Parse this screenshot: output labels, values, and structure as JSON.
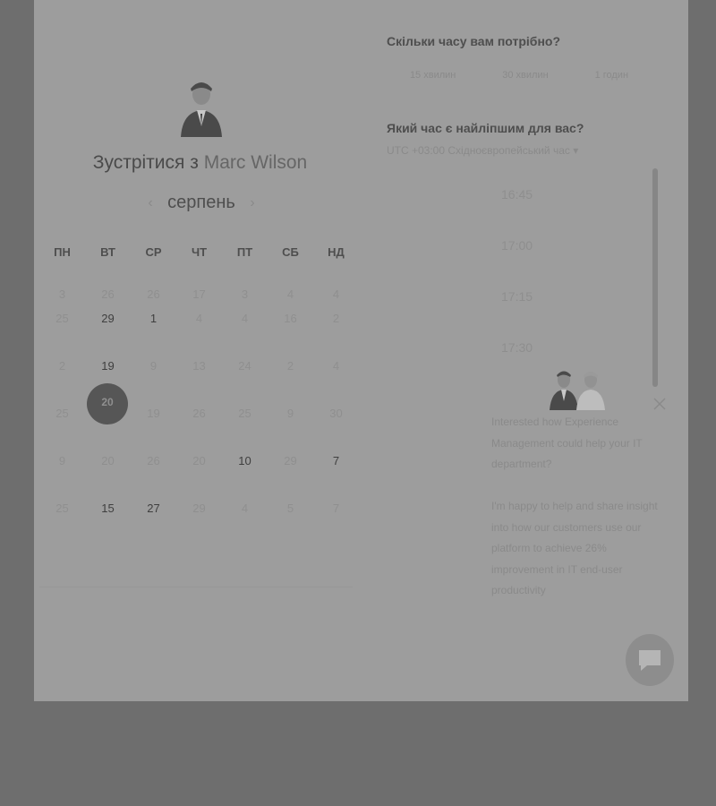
{
  "header": {
    "title_prefix": "Зустрітися з ",
    "host_name": "Marc Wilson",
    "month": "серпень",
    "prev_icon": "chevron-left-icon",
    "next_icon": "chevron-right-icon"
  },
  "calendar": {
    "weekdays": [
      "ПН",
      "ВТ",
      "СР",
      "ЧТ",
      "ПТ",
      "СБ",
      "НД"
    ],
    "weeks": [
      [
        "3",
        "26",
        "26",
        "17",
        "3",
        "4",
        "4"
      ],
      [
        "25",
        "29",
        "1",
        "4",
        "4",
        "16",
        "2"
      ],
      [
        "2",
        "19",
        "9",
        "13",
        "24",
        "2",
        "4"
      ],
      [
        "25",
        "20",
        "19",
        "26",
        "25",
        "9",
        "30"
      ],
      [
        "9",
        "20",
        "26",
        "20",
        "10",
        "29",
        "7"
      ],
      [
        "25",
        "15",
        "27",
        "29",
        "4",
        "5",
        "7"
      ]
    ],
    "available": [
      [
        false,
        false,
        false,
        false,
        false,
        false,
        false
      ],
      [
        false,
        true,
        true,
        false,
        false,
        false,
        false
      ],
      [
        false,
        true,
        false,
        false,
        false,
        false,
        false
      ],
      [
        false,
        true,
        false,
        false,
        false,
        false,
        false
      ],
      [
        false,
        false,
        false,
        false,
        true,
        false,
        true
      ],
      [
        false,
        true,
        true,
        false,
        false,
        false,
        false
      ]
    ],
    "selected_day": "20"
  },
  "duration": {
    "question": "Скільки часу вам потрібно?",
    "options": [
      "15 хвилин",
      "30 хвилин",
      "1 годин"
    ]
  },
  "time": {
    "question": "Який час є найліпшим для вас?",
    "timezone": "UTC +03:00 Східноєвропейський час",
    "timezone_icon": "caret-down-icon",
    "slots": [
      "16:45",
      "17:00",
      "17:15",
      "17:30"
    ]
  },
  "chat": {
    "paragraph1": "Interested how Experience Management could help your IT department?",
    "paragraph2": "I'm happy to help and share insight into how our customers use our platform to achieve 26% improvement in IT end-user productivity",
    "close_icon": "close-icon",
    "button_icon": "chat-bubble-icon"
  }
}
